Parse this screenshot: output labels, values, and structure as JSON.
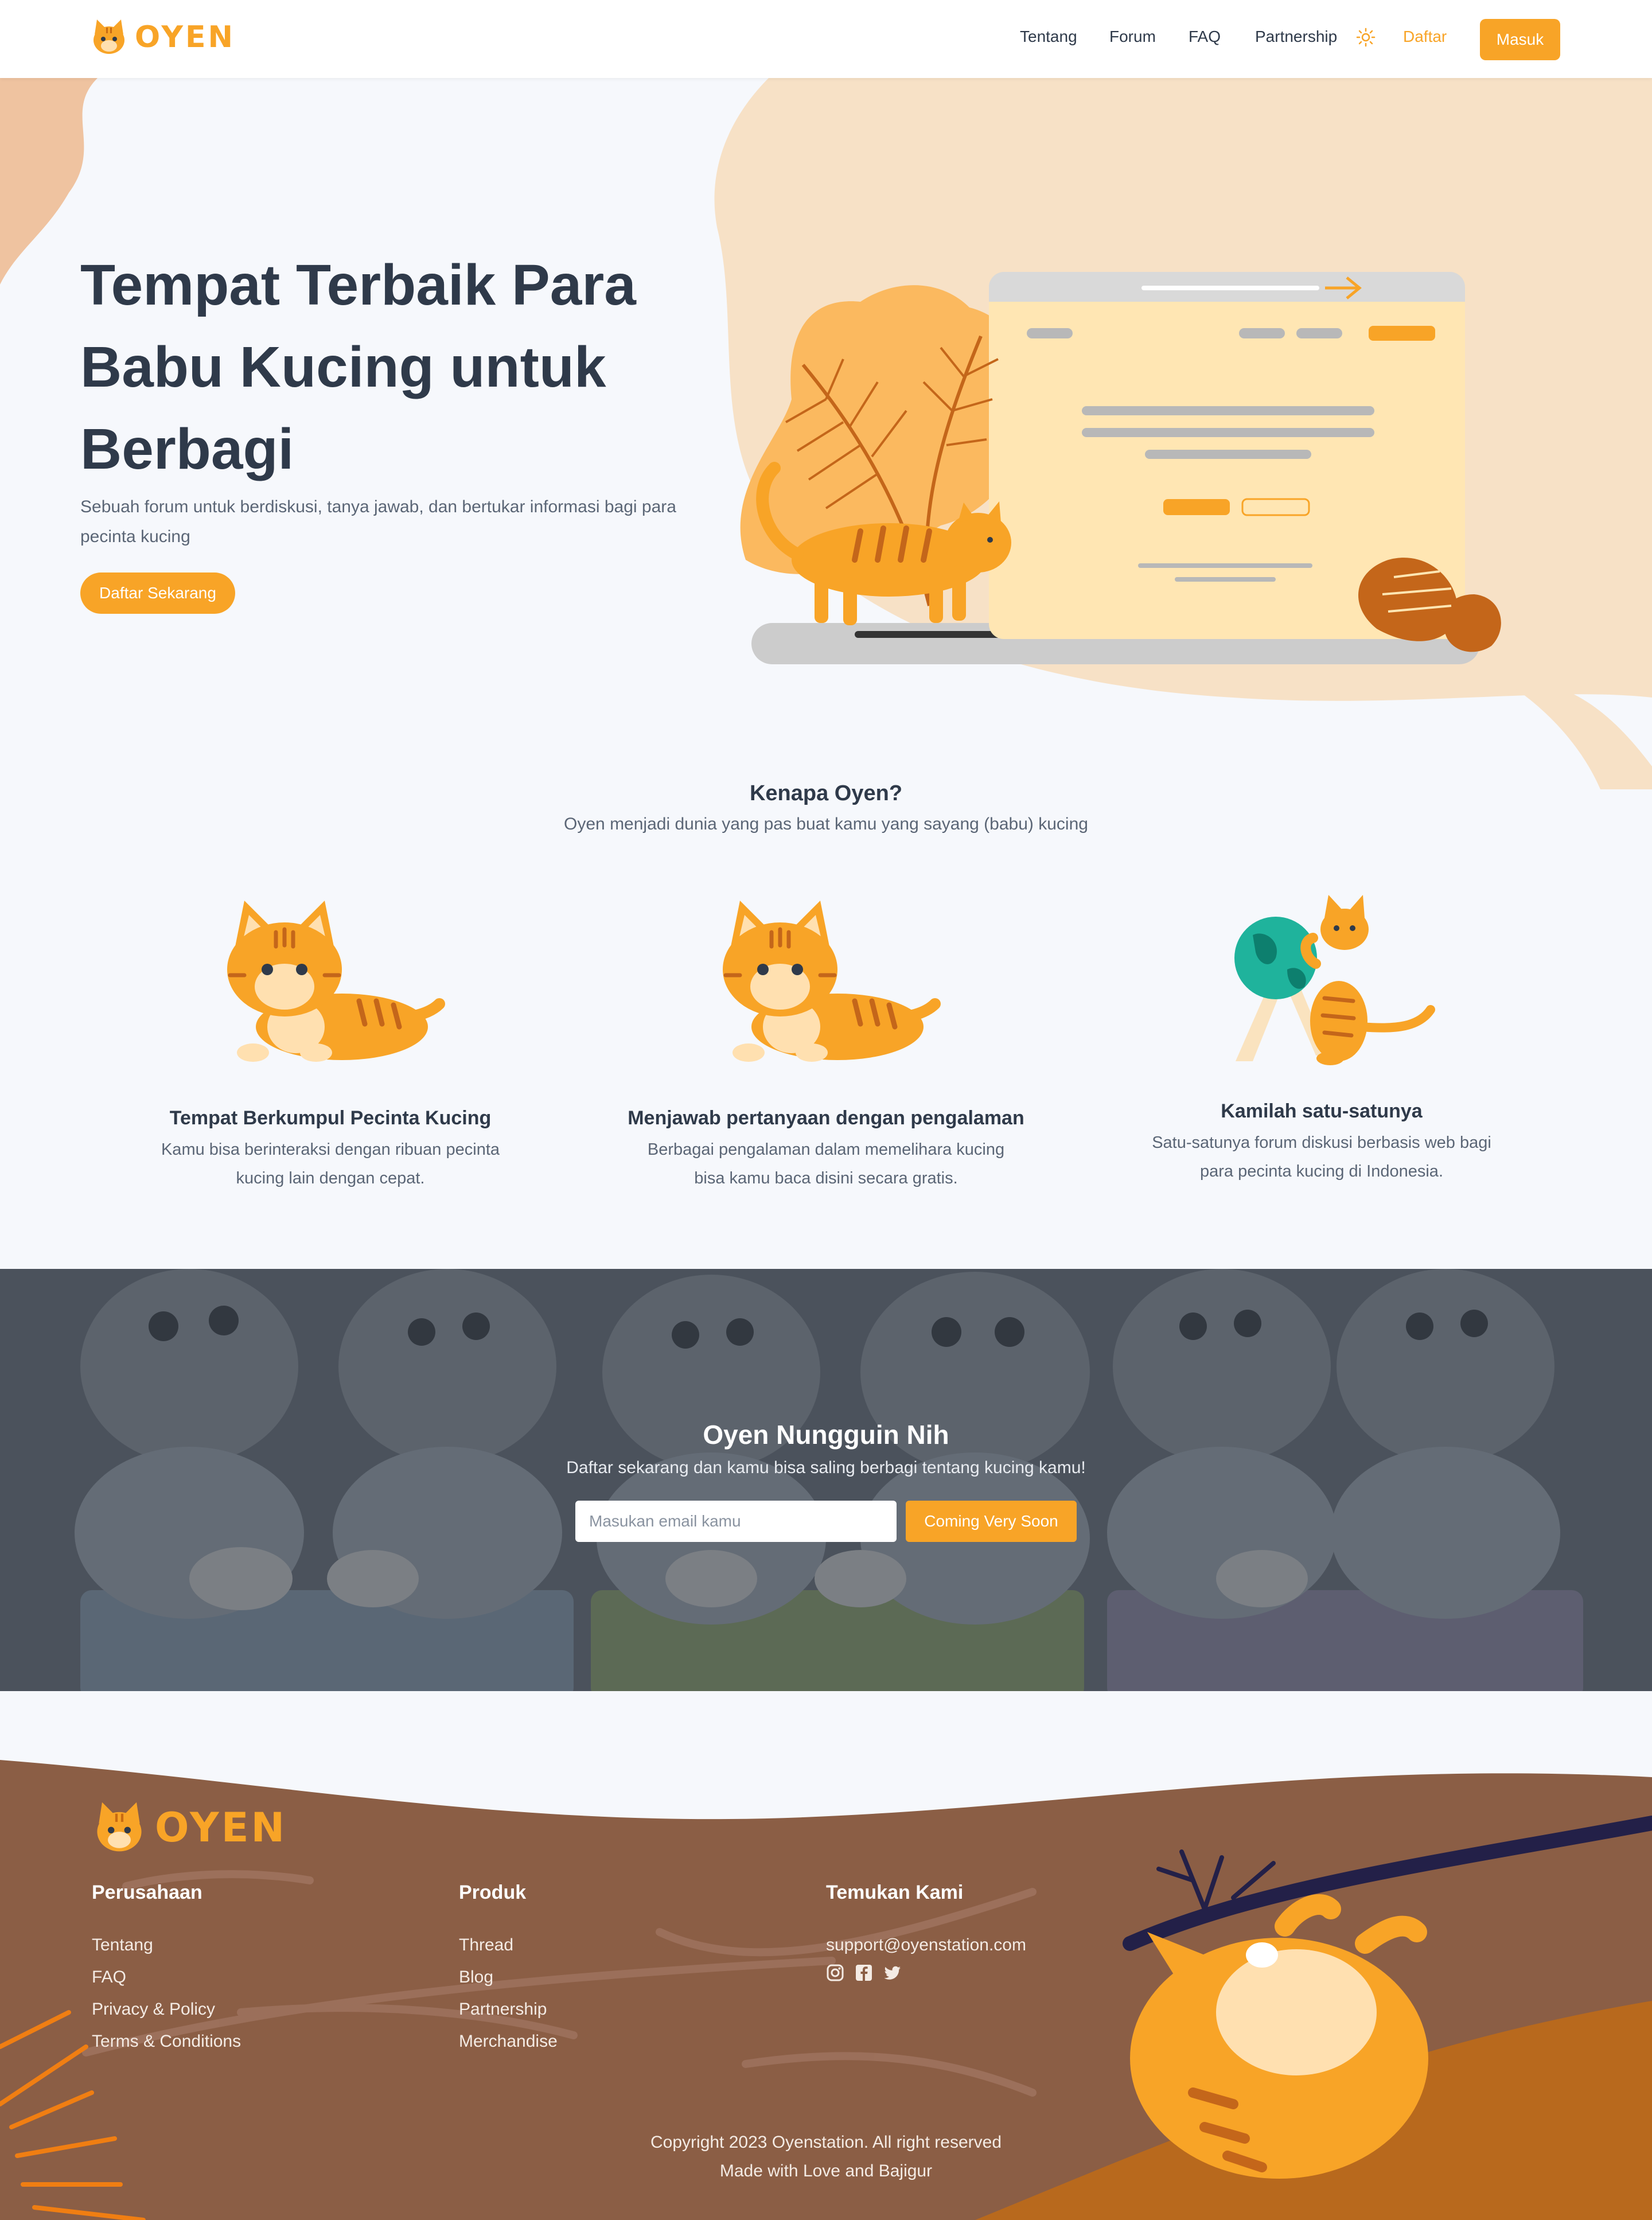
{
  "brand": {
    "name": "OYEN",
    "accent": "#f8a427",
    "text_dark": "#2f3a4a",
    "footer_brown": "#8b5e45"
  },
  "nav": {
    "links": [
      "Tentang",
      "Forum",
      "FAQ",
      "Partnership"
    ],
    "theme_icon": "sun-icon",
    "register": "Daftar",
    "login": "Masuk"
  },
  "hero": {
    "title": "Tempat Terbaik Para Babu Kucing untuk Berbagi",
    "subtitle": "Sebuah forum untuk berdiskusi, tanya jawab, dan bertukar informasi bagi para pecinta kucing",
    "cta": "Daftar Sekarang"
  },
  "why": {
    "title": "Kenapa Oyen?",
    "subtitle": "Oyen menjadi dunia yang pas buat kamu yang sayang (babu) kucing",
    "features": [
      {
        "icon": "cat-lying-icon",
        "title": "Tempat Berkumpul Pecinta Kucing",
        "desc": "Kamu bisa berinteraksi dengan ribuan pecinta kucing lain dengan cepat."
      },
      {
        "icon": "cat-lying-icon",
        "title": "Menjawab pertanyaan dengan pengalaman",
        "desc": "Berbagai pengalaman dalam memelihara kucing bisa kamu baca disini secara gratis."
      },
      {
        "icon": "cat-globe-icon",
        "title": "Kamilah satu-satunya",
        "desc": "Satu-satunya forum diskusi berbasis web bagi para pecinta kucing di Indonesia."
      }
    ]
  },
  "newsletter": {
    "title": "Oyen Nungguin Nih",
    "subtitle": "Daftar sekarang dan kamu bisa saling berbagi tentang kucing kamu!",
    "email_placeholder": "Masukan email kamu",
    "button": "Coming Very Soon"
  },
  "footer": {
    "columns": [
      {
        "heading": "Perusahaan",
        "links": [
          "Tentang",
          "FAQ",
          "Privacy & Policy",
          "Terms & Conditions"
        ]
      },
      {
        "heading": "Produk",
        "links": [
          "Thread",
          "Blog",
          "Partnership",
          "Merchandise"
        ]
      },
      {
        "heading": "Temukan Kami",
        "email": "support@oyenstation.com",
        "social_icons": [
          "instagram-icon",
          "facebook-icon",
          "twitter-icon"
        ]
      }
    ],
    "copyright": "Copyright 2023 Oyenstation. All right reserved",
    "tagline": "Made with Love and Bajigur"
  }
}
